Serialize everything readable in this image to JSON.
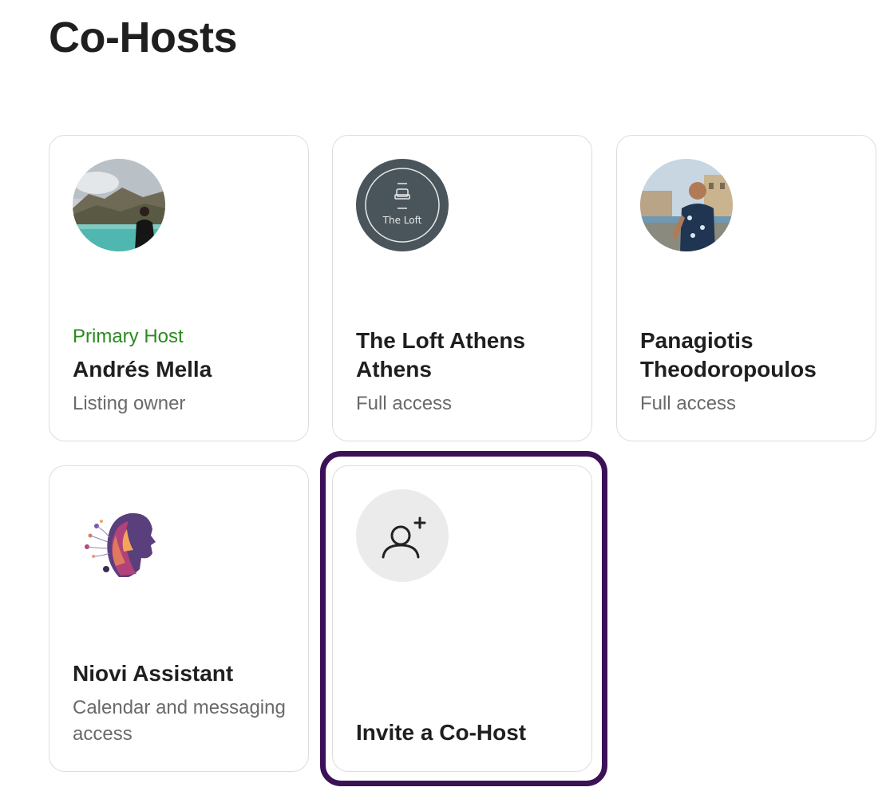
{
  "page": {
    "title": "Co-Hosts"
  },
  "cohosts": [
    {
      "role": "Primary Host",
      "name": "Andrés Mella",
      "access": "Listing owner",
      "avatar": "person-photo-mountain-lake"
    },
    {
      "name": "The Loft Athens Athens",
      "access": "Full access",
      "avatar": "the-loft-logo",
      "logo_text": "The Loft"
    },
    {
      "name": "Panagiotis Theodoropoulos",
      "access": "Full access",
      "avatar": "person-photo-city"
    },
    {
      "name": "Niovi Assistant",
      "access": "Calendar and messaging access",
      "avatar": "ai-woman-profile-art"
    }
  ],
  "invite": {
    "label": "Invite a Co-Host",
    "icon": "add-person-icon"
  },
  "colors": {
    "primary_host_green": "#2b8a1f",
    "highlight_border": "#3b1257",
    "logo_bg": "#4a555b"
  }
}
